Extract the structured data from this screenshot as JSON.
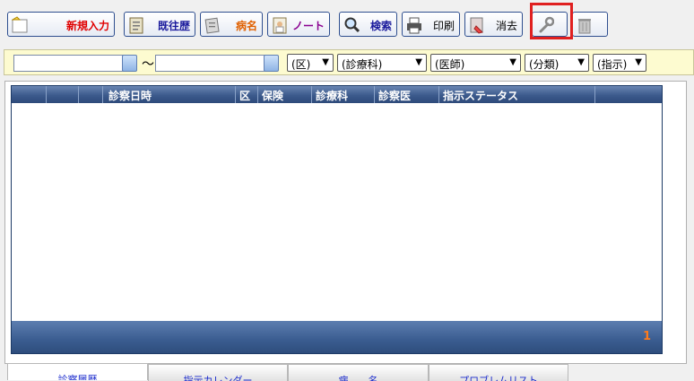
{
  "toolbar": {
    "buttons": [
      {
        "label": "新規入力",
        "color": "#e00000",
        "icon": "folder-icon"
      },
      {
        "label": "既往歴",
        "color": "#1a1a9c",
        "icon": "clipboard-icon"
      },
      {
        "label": "病名",
        "color": "#e06000",
        "icon": "memo-icon"
      },
      {
        "label": "ノート",
        "color": "#8a0090",
        "icon": "doctor-note-icon"
      },
      {
        "label": "検索",
        "color": "#1a1a9c",
        "icon": "search-icon"
      },
      {
        "label": "印刷",
        "color": "#000000",
        "icon": "printer-icon"
      },
      {
        "label": "消去",
        "color": "#000000",
        "icon": "erase-icon"
      },
      {
        "label": "",
        "icon": "wrench-icon"
      },
      {
        "label": "",
        "icon": "trash-icon"
      }
    ]
  },
  "filter": {
    "date_from": "",
    "date_to": "",
    "separator": "～",
    "dropdowns": [
      {
        "value": "(区)"
      },
      {
        "value": "(診療科)"
      },
      {
        "value": "(医師)"
      },
      {
        "value": "(分類)"
      },
      {
        "value": "(指示)"
      }
    ]
  },
  "table": {
    "columns": [
      "",
      "",
      "",
      "診察日時",
      "区",
      "保険",
      "診療科",
      "診察医",
      "指示ステータス",
      ""
    ],
    "rows": [],
    "page": "1"
  },
  "tabs": [
    {
      "label": "診察履歴",
      "active": true
    },
    {
      "label": "指示カレンダー",
      "active": false
    },
    {
      "label": "病　　名",
      "active": false
    },
    {
      "label": "プロブレムリスト",
      "active": false
    }
  ],
  "colors": {
    "header": "#3c5a8c",
    "filter_bg": "#fdfbd0",
    "page_number": "#ff7a1a",
    "highlight": "#e02020"
  }
}
